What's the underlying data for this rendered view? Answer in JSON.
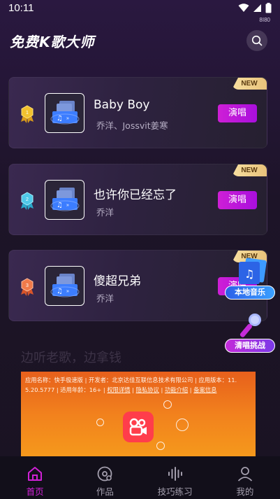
{
  "status_bar": {
    "time": "10:11",
    "net_speed": "8I80"
  },
  "header": {
    "title": "免费K歌大师"
  },
  "songs": [
    {
      "badge": "NEW",
      "rank": "1",
      "title": "Baby Boy",
      "artist": "乔洋、Jossvit姜寒",
      "action": "演唱",
      "medal_color": "#f2c12e"
    },
    {
      "badge": "NEW",
      "rank": "2",
      "title": "也许你已经忘了",
      "artist": "乔洋",
      "action": "演唱",
      "medal_color": "#4fc8e8"
    },
    {
      "badge": "NEW",
      "rank": "3",
      "title": "傻超兄弟",
      "artist": "乔洋",
      "action": "演唱",
      "medal_color": "#f07a4a"
    }
  ],
  "floating": {
    "local_music": "本地音乐",
    "challenge": "清唱挑战"
  },
  "slogan": "边听老歌，边拿钱",
  "ad": {
    "line1": "应用名称：快手极速版 | 开发者：北京达佳互联信息技术有限公司 | 应用版本：11.",
    "line2_prefix": "5.20.5777 | 适用年龄：16+ | ",
    "link_permissions": "权限详情",
    "link_privacy": "隐私协议",
    "link_features": "功能介绍",
    "link_filing": "备案信息",
    "sep": " | "
  },
  "tabs": [
    {
      "label": "首页",
      "icon": "home-icon",
      "active": true
    },
    {
      "label": "作品",
      "icon": "disc-icon",
      "active": false
    },
    {
      "label": "技巧练习",
      "icon": "waveform-icon",
      "active": false
    },
    {
      "label": "我的",
      "icon": "person-icon",
      "active": false
    }
  ],
  "colors": {
    "accent": "#d021d6",
    "background": "#1d1428"
  }
}
